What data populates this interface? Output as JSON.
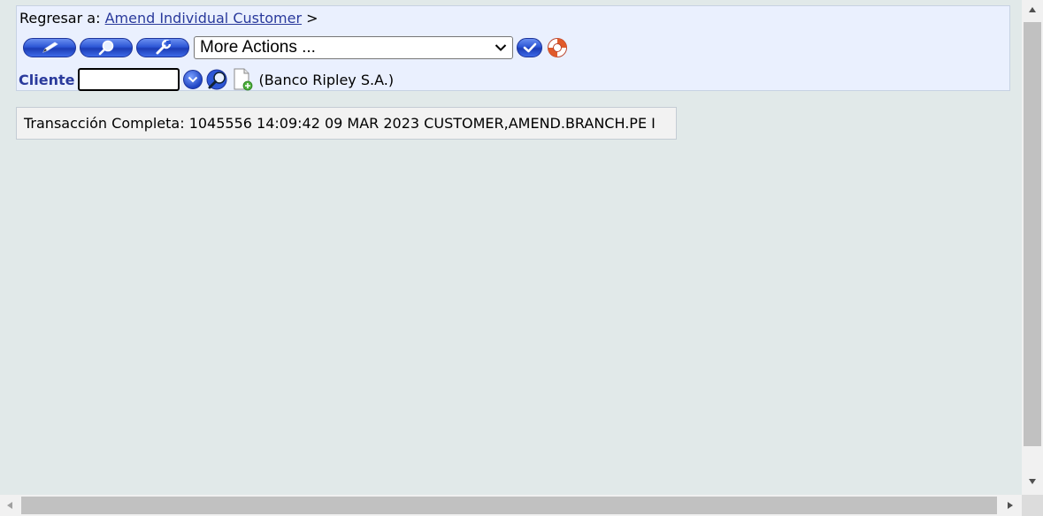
{
  "breadcrumb": {
    "prefix": "Regresar a:",
    "link": "Amend Individual Customer",
    "separator": ">"
  },
  "toolbar": {
    "buttons": [
      {
        "icon": "pencil-icon"
      },
      {
        "icon": "magnifier-icon"
      },
      {
        "icon": "wrench-icon"
      }
    ],
    "actions_select": {
      "selected": "More Actions ..."
    },
    "go_icon": "checkmark-icon",
    "help_icon": "lifebuoy-icon"
  },
  "client": {
    "label": "Cliente",
    "value": "",
    "bank": "(Banco Ripley S.A.)"
  },
  "message": {
    "text": "Transacción Completa: 1045556 14:09:42 09 MAR 2023 CUSTOMER,AMEND.BRANCH.PE I"
  },
  "colors": {
    "page_bg": "#e1e9e9",
    "panel_bg": "#eaf0fe",
    "label_blue": "#2a3a9c",
    "button_blue": "#2d57d6"
  }
}
